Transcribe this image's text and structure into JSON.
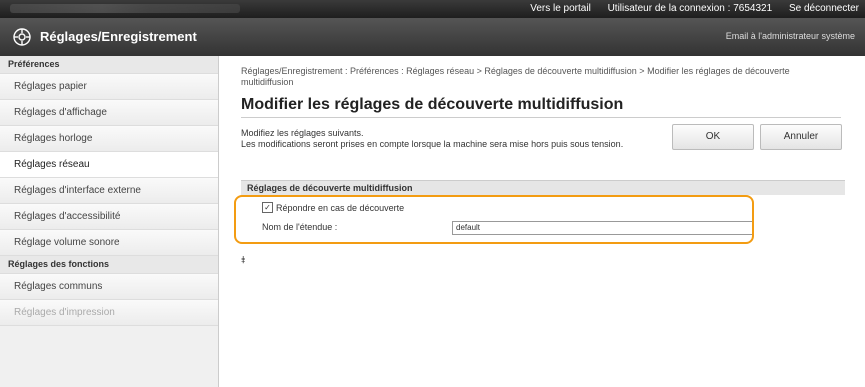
{
  "topbar": {
    "portal_link": "Vers le portail",
    "user_label": "Utilisateur de la connexion :",
    "user_id": "7654321",
    "logout_link": "Se déconnecter"
  },
  "header": {
    "title": "Réglages/Enregistrement",
    "email_link": "Email à l'administrateur système"
  },
  "sidebar": {
    "section_preferences": "Préférences",
    "items": [
      {
        "label": "Réglages papier"
      },
      {
        "label": "Réglages d'affichage"
      },
      {
        "label": "Réglages horloge"
      },
      {
        "label": "Réglages réseau"
      },
      {
        "label": "Réglages d'interface externe"
      },
      {
        "label": "Réglages d'accessibilité"
      },
      {
        "label": "Réglage volume sonore"
      }
    ],
    "section_functions": "Réglages des fonctions",
    "function_items": [
      {
        "label": "Réglages communs"
      },
      {
        "label": "Réglages d'impression"
      }
    ]
  },
  "main": {
    "breadcrumb": "Réglages/Enregistrement : Préférences : Réglages réseau > Réglages de découverte multidiffusion > Modifier les réglages de découverte multidiffusion",
    "title": "Modifier les réglages de découverte multidiffusion",
    "description_line1": "Modifiez les réglages suivants.",
    "description_line2": "Les modifications seront prises en compte lorsque la machine sera mise hors puis sous tension.",
    "ok_label": "OK",
    "cancel_label": "Annuler",
    "section_title": "Réglages de découverte multidiffusion",
    "checkbox_label": "Répondre en cas de découverte",
    "checkbox_mark": "✓",
    "scope_label": "Nom de l'étendue :",
    "scope_value": "default",
    "to_top_icon": "⯒"
  }
}
